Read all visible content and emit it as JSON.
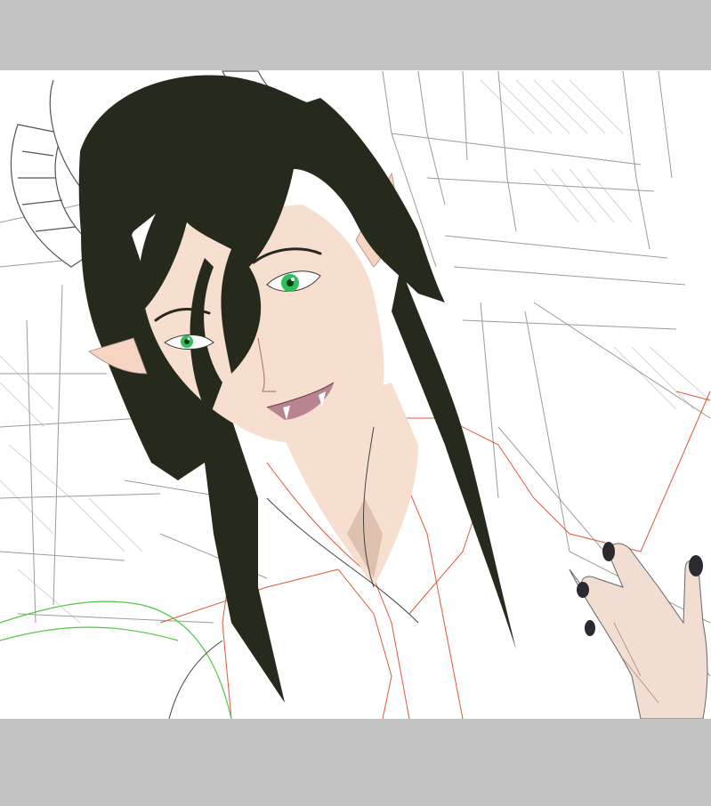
{
  "canvas": {
    "background": "#c3c3c3",
    "paper": "#ffffff"
  },
  "artwork": {
    "subject": "illustration-demon-character",
    "colors": {
      "hair": "#262a1c",
      "skin": "#f7dfcf",
      "eyes": "#2fbf5a",
      "nails": "#2a2a30",
      "sketch_line": "#6a6a6a",
      "red_sketch": "#e0573a",
      "green_sketch": "#4fc943"
    }
  }
}
